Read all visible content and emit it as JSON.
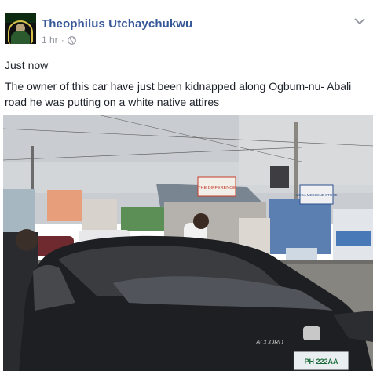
{
  "post": {
    "author": "Theophilus Utchaychukwu",
    "time": "1 hr",
    "separator": "·",
    "privacy_icon": "globe-icon",
    "menu_icon": "chevron-down-icon",
    "text_line1": "Just now",
    "text_line2": "The owner of this car have just been kidnapped along Ogbum-nu- Abali road he was putting on a white native attires"
  },
  "photo": {
    "shop_sign_left": "THE DIFFERENCE",
    "shop_sign_right": "MEGA MEDICINE STORE",
    "car_badge": "ACCORD",
    "plate": "PH 222AA"
  },
  "colors": {
    "author_link": "#365899",
    "meta_gray": "#90949c",
    "text": "#1d2129"
  }
}
